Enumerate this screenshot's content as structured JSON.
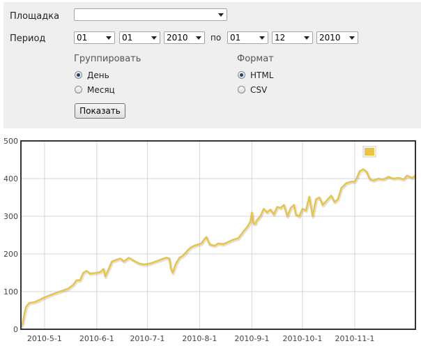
{
  "form": {
    "site_label": "Площадка",
    "site_value": "",
    "period_label": "Период",
    "from_day": "01",
    "from_month": "01",
    "from_year": "2010",
    "to_label": "по",
    "to_day": "01",
    "to_month": "12",
    "to_year": "2010",
    "group_label": "Группировать",
    "group_options": [
      "День",
      "Месяц"
    ],
    "group_selected": "День",
    "format_label": "Формат",
    "format_options": [
      "HTML",
      "CSV"
    ],
    "format_selected": "HTML",
    "submit_label": "Показать"
  },
  "chart_data": {
    "type": "line",
    "ylim": [
      0,
      500
    ],
    "yticks": [
      0,
      100,
      200,
      300,
      400,
      500
    ],
    "xlim": [
      "2010-04-17",
      "2010-12-07"
    ],
    "xticks": [
      "2010-5-1",
      "2010-6-1",
      "2010-7-1",
      "2010-8-1",
      "2010-9-1",
      "2010-10-1",
      "2010-11-1"
    ],
    "grid": true,
    "legend": "top-right",
    "colors": {
      "line": "#e8c547",
      "grid": "#d4d4d4",
      "frame": "#333333"
    },
    "series": [
      {
        "name": "",
        "x": [
          "2010-04-17",
          "2010-04-18",
          "2010-04-19",
          "2010-04-20",
          "2010-04-22",
          "2010-04-25",
          "2010-04-28",
          "2010-05-01",
          "2010-05-05",
          "2010-05-10",
          "2010-05-15",
          "2010-05-18",
          "2010-05-20",
          "2010-05-22",
          "2010-05-24",
          "2010-05-26",
          "2010-05-28",
          "2010-06-01",
          "2010-06-03",
          "2010-06-05",
          "2010-06-06",
          "2010-06-08",
          "2010-06-10",
          "2010-06-13",
          "2010-06-15",
          "2010-06-17",
          "2010-06-20",
          "2010-06-23",
          "2010-06-26",
          "2010-06-29",
          "2010-07-03",
          "2010-07-06",
          "2010-07-09",
          "2010-07-12",
          "2010-07-14",
          "2010-07-15",
          "2010-07-16",
          "2010-07-18",
          "2010-07-20",
          "2010-07-22",
          "2010-07-25",
          "2010-07-27",
          "2010-07-29",
          "2010-07-31",
          "2010-08-02",
          "2010-08-04",
          "2010-08-05",
          "2010-08-07",
          "2010-08-10",
          "2010-08-12",
          "2010-08-15",
          "2010-08-18",
          "2010-08-21",
          "2010-08-24",
          "2010-08-27",
          "2010-08-29",
          "2010-08-31",
          "2010-09-01",
          "2010-09-02",
          "2010-09-03",
          "2010-09-04",
          "2010-09-06",
          "2010-09-08",
          "2010-09-10",
          "2010-09-12",
          "2010-09-14",
          "2010-09-16",
          "2010-09-18",
          "2010-09-20",
          "2010-09-22",
          "2010-09-24",
          "2010-09-26",
          "2010-09-27",
          "2010-09-29",
          "2010-10-01",
          "2010-10-03",
          "2010-10-05",
          "2010-10-07",
          "2010-10-09",
          "2010-10-11",
          "2010-10-13",
          "2010-10-15",
          "2010-10-18",
          "2010-10-20",
          "2010-10-22",
          "2010-10-24",
          "2010-10-27",
          "2010-10-30",
          "2010-11-01",
          "2010-11-02",
          "2010-11-04",
          "2010-11-06",
          "2010-11-08",
          "2010-11-10",
          "2010-11-12",
          "2010-11-15",
          "2010-11-18",
          "2010-11-21",
          "2010-11-24",
          "2010-11-27",
          "2010-11-30",
          "2010-12-02",
          "2010-12-05",
          "2010-12-07"
        ],
        "y": [
          5,
          15,
          40,
          60,
          70,
          72,
          78,
          85,
          92,
          100,
          108,
          118,
          130,
          130,
          150,
          155,
          148,
          150,
          152,
          160,
          140,
          160,
          180,
          185,
          188,
          180,
          190,
          182,
          175,
          172,
          175,
          180,
          185,
          190,
          188,
          160,
          150,
          175,
          190,
          195,
          210,
          218,
          222,
          225,
          228,
          240,
          245,
          225,
          222,
          228,
          226,
          232,
          238,
          242,
          260,
          270,
          285,
          310,
          280,
          280,
          290,
          300,
          320,
          310,
          318,
          305,
          325,
          322,
          330,
          300,
          322,
          330,
          305,
          300,
          320,
          315,
          352,
          300,
          345,
          350,
          330,
          340,
          355,
          338,
          345,
          375,
          388,
          392,
          392,
          400,
          420,
          425,
          418,
          398,
          395,
          400,
          398,
          405,
          400,
          402,
          398,
          408,
          402,
          408
        ]
      }
    ]
  }
}
